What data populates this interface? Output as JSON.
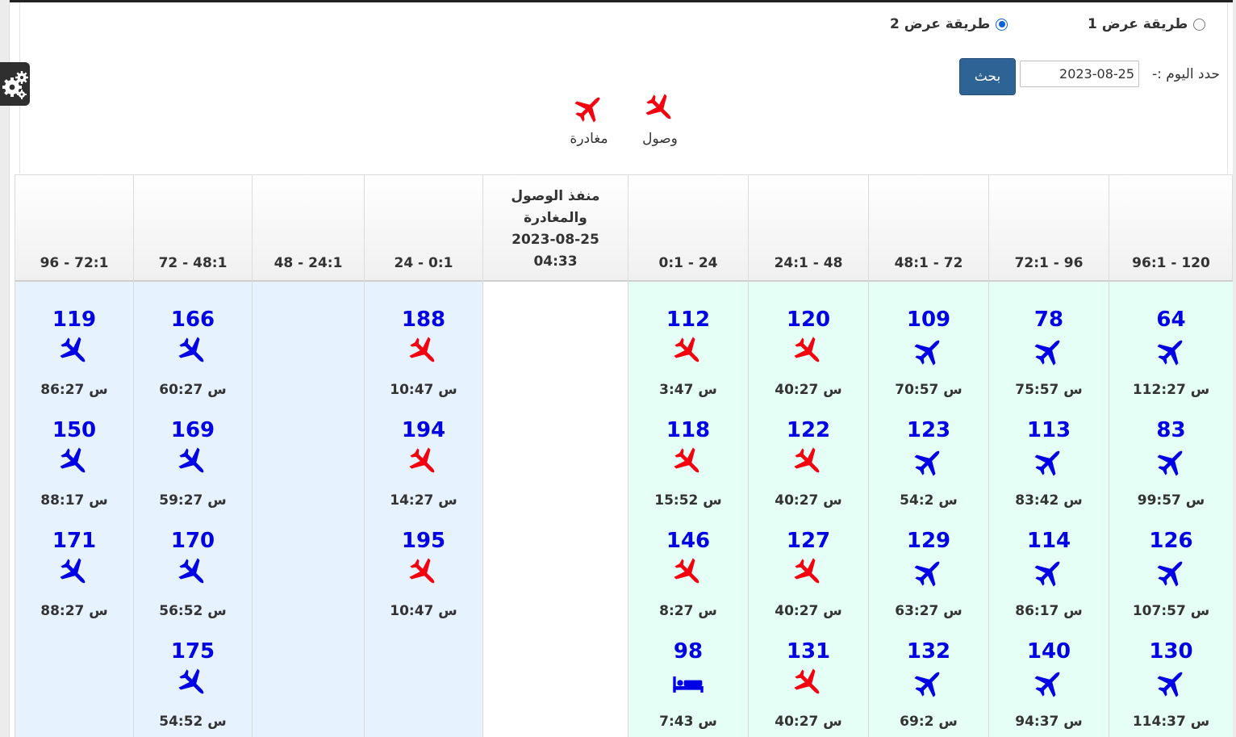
{
  "display_mode": {
    "option1_label": "طريقة عرض 1",
    "option2_label": "طريقة عرض 2",
    "selected": 2
  },
  "date_filter": {
    "label": "حدد اليوم :-",
    "value": "2023-08-25",
    "search_label": "بحث"
  },
  "legend": {
    "arrival_label": "وصول",
    "departure_label": "مغادرة"
  },
  "colors": {
    "arrival": "#0000e6",
    "departure": "#f5000f",
    "number": "#0000e6",
    "green_bg": "#e6fff6",
    "blue_bg": "#e6f2fe"
  },
  "center_header": {
    "line1": "منفذ الوصول",
    "line2": "والمغادرة",
    "date": "2023-08-25",
    "time": "04:33"
  },
  "columns": [
    {
      "header": "96:1 - 120",
      "flights": [
        {
          "number": "64",
          "icon": "airplane-arrival-icon",
          "time": "112:27 س"
        },
        {
          "number": "83",
          "icon": "airplane-arrival-icon",
          "time": "99:57 س"
        },
        {
          "number": "126",
          "icon": "airplane-arrival-icon",
          "time": "107:57 س"
        },
        {
          "number": "130",
          "icon": "airplane-arrival-icon",
          "time": "114:37 س"
        }
      ]
    },
    {
      "header": "72:1 - 96",
      "flights": [
        {
          "number": "78",
          "icon": "airplane-arrival-icon",
          "time": "75:57 س"
        },
        {
          "number": "113",
          "icon": "airplane-arrival-icon",
          "time": "83:42 س"
        },
        {
          "number": "114",
          "icon": "airplane-arrival-icon",
          "time": "86:17 س"
        },
        {
          "number": "140",
          "icon": "airplane-arrival-icon",
          "time": "94:37 س"
        }
      ]
    },
    {
      "header": "48:1 - 72",
      "flights": [
        {
          "number": "109",
          "icon": "airplane-arrival-icon",
          "time": "70:57 س"
        },
        {
          "number": "123",
          "icon": "airplane-arrival-icon",
          "time": "54:2 س"
        },
        {
          "number": "129",
          "icon": "airplane-arrival-icon",
          "time": "63:27 س"
        },
        {
          "number": "132",
          "icon": "airplane-arrival-icon",
          "time": "69:2 س"
        }
      ]
    },
    {
      "header": "24:1 - 48",
      "flights": [
        {
          "number": "120",
          "icon": "airplane-departure-icon",
          "time": "40:27 س"
        },
        {
          "number": "122",
          "icon": "airplane-departure-icon",
          "time": "40:27 س"
        },
        {
          "number": "127",
          "icon": "airplane-departure-icon",
          "time": "40:27 س"
        },
        {
          "number": "131",
          "icon": "airplane-departure-icon",
          "time": "40:27 س"
        }
      ]
    },
    {
      "header": "0:1 - 24",
      "flights": [
        {
          "number": "112",
          "icon": "airplane-departure-icon",
          "time": "3:47 س"
        },
        {
          "number": "118",
          "icon": "airplane-departure-icon",
          "time": "15:52 س"
        },
        {
          "number": "146",
          "icon": "airplane-departure-icon",
          "time": "8:27 س"
        },
        {
          "number": "98",
          "icon": "bed-icon",
          "time": "7:43 س"
        }
      ]
    },
    {
      "header": "24 - 0:1",
      "flights": [
        {
          "number": "188",
          "icon": "airplane-departure-icon",
          "time": "10:47 س"
        },
        {
          "number": "194",
          "icon": "airplane-departure-icon",
          "time": "14:27 س"
        },
        {
          "number": "195",
          "icon": "airplane-departure-icon",
          "time": "10:47 س"
        }
      ]
    },
    {
      "header": "48 - 24:1",
      "flights": []
    },
    {
      "header": "72 - 48:1",
      "flights": [
        {
          "number": "166",
          "icon": "airplane-outbound-icon",
          "time": "60:27 س"
        },
        {
          "number": "169",
          "icon": "airplane-outbound-icon",
          "time": "59:27 س"
        },
        {
          "number": "170",
          "icon": "airplane-outbound-icon",
          "time": "56:52 س"
        },
        {
          "number": "175",
          "icon": "airplane-outbound-icon",
          "time": "54:52 س"
        }
      ]
    },
    {
      "header": "96 - 72:1",
      "flights": [
        {
          "number": "119",
          "icon": "airplane-outbound-icon",
          "time": "86:27 س"
        },
        {
          "number": "150",
          "icon": "airplane-outbound-icon",
          "time": "88:17 س"
        },
        {
          "number": "171",
          "icon": "airplane-outbound-icon",
          "time": "88:27 س"
        }
      ]
    }
  ]
}
